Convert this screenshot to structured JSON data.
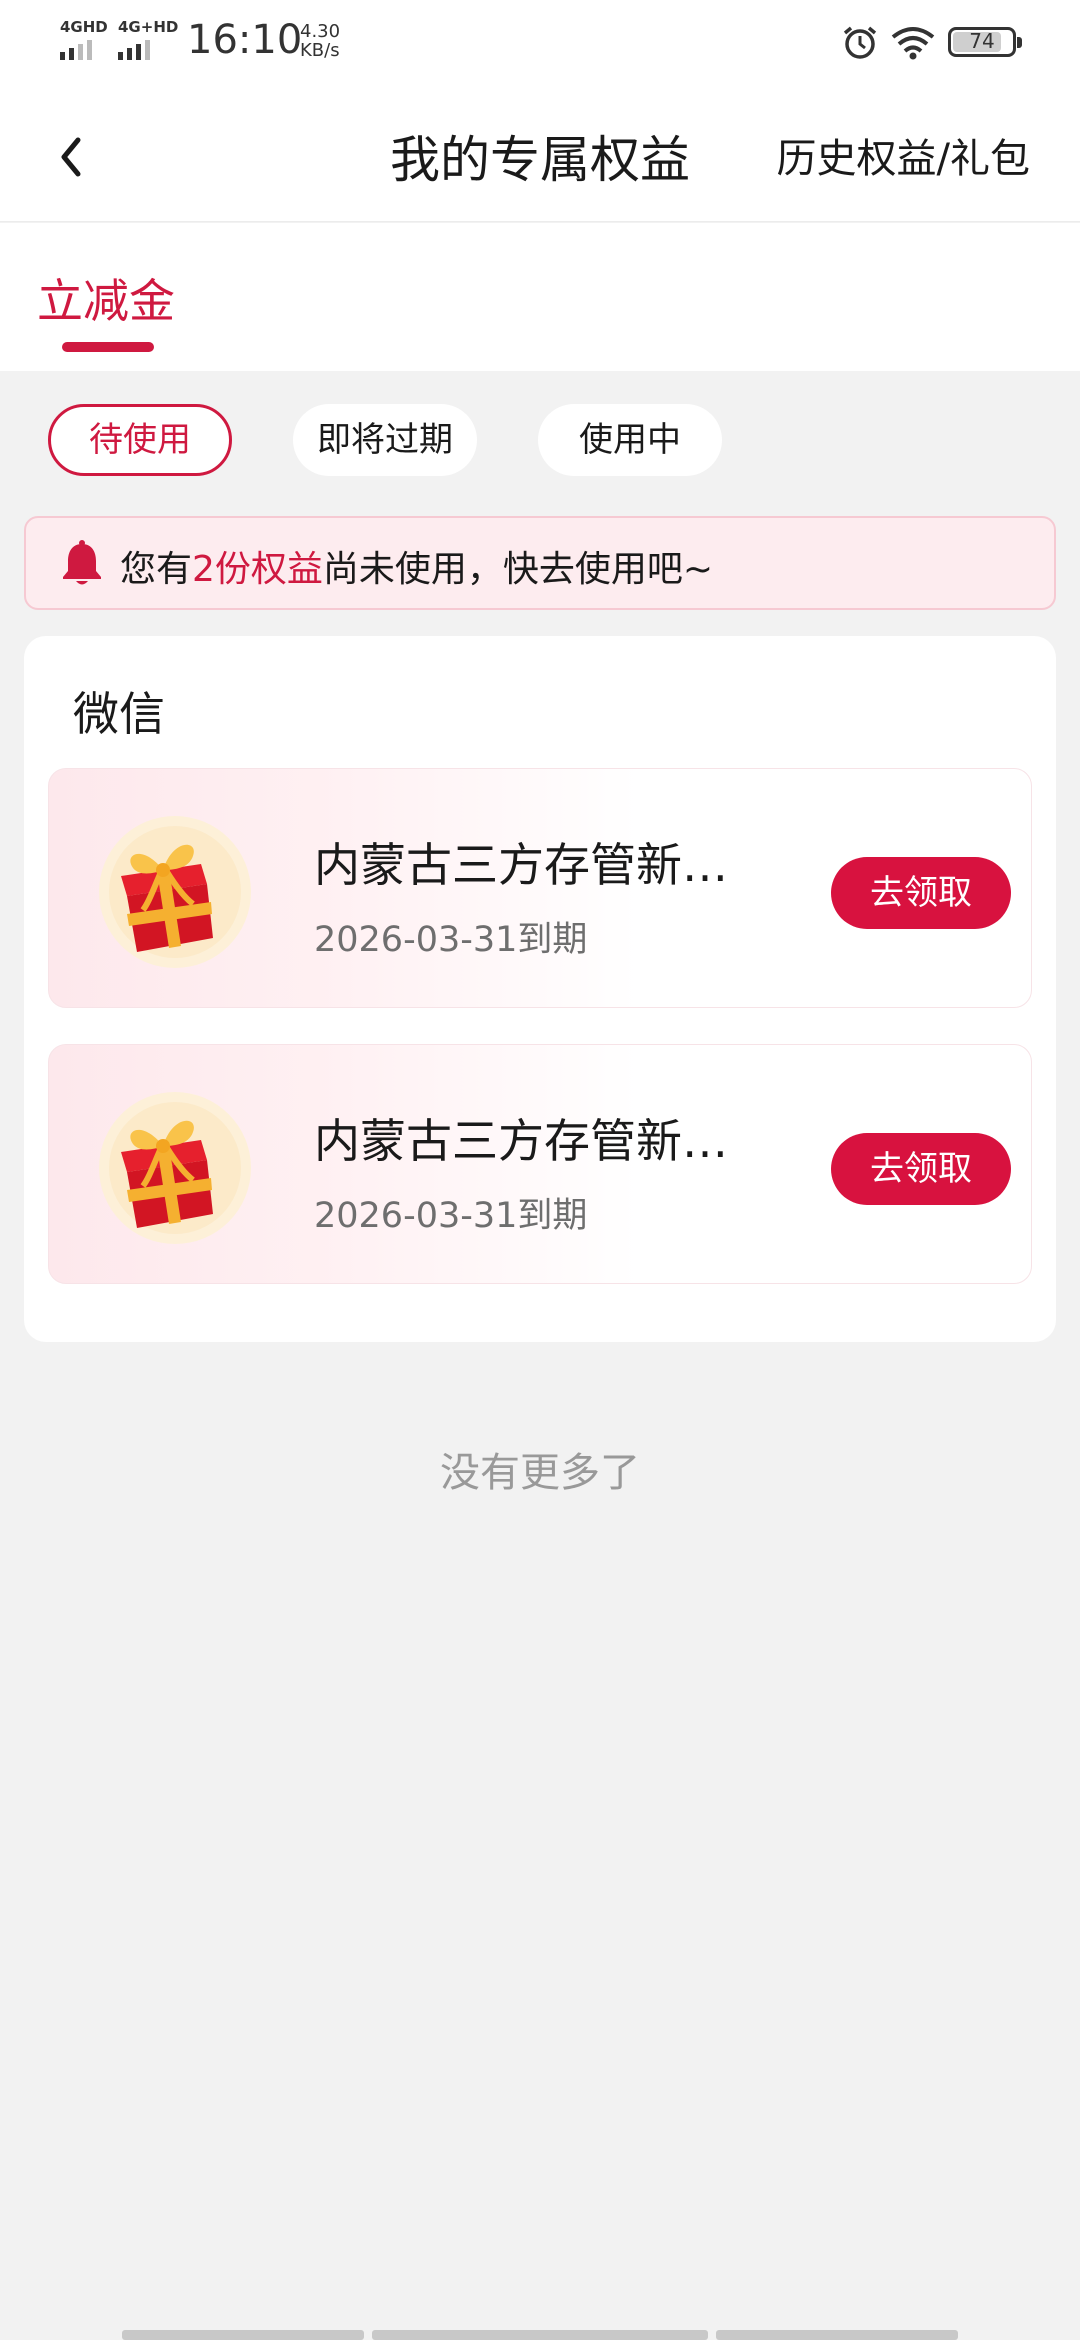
{
  "status_bar": {
    "sim1": "4GHD",
    "sim2": "4G+HD",
    "time": "16:10",
    "speed_value": "4.30",
    "speed_unit": "KB/s",
    "battery": "74",
    "icons": [
      "alarm-icon",
      "wifi-icon",
      "battery-icon"
    ]
  },
  "header": {
    "back_icon": "chevron-left-icon",
    "title": "我的专属权益",
    "history_link": "历史权益/礼包"
  },
  "tabs": [
    {
      "label": "立减金",
      "active": true
    }
  ],
  "filters": [
    {
      "label": "待使用",
      "active": true
    },
    {
      "label": "即将过期",
      "active": false
    },
    {
      "label": "使用中",
      "active": false
    }
  ],
  "notice": {
    "icon": "bell-icon",
    "prefix": "您有",
    "highlight": "2份权益",
    "suffix": "尚未使用，快去使用吧~"
  },
  "section": {
    "title": "微信",
    "coupons": [
      {
        "icon": "gift-box-icon",
        "name": "内蒙古三方存管新…",
        "expiry": "2026-03-31到期",
        "button": "去领取"
      },
      {
        "icon": "gift-box-icon",
        "name": "内蒙古三方存管新…",
        "expiry": "2026-03-31到期",
        "button": "去领取"
      }
    ]
  },
  "footer_text": "没有更多了",
  "colors": {
    "accent": "#cf1940",
    "button": "#d8123f",
    "notice_bg": "#fdecef",
    "page_bg": "#f2f2f2"
  }
}
